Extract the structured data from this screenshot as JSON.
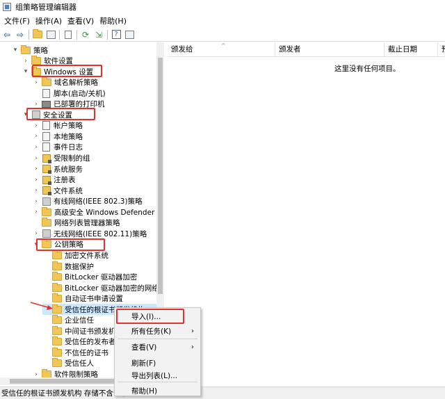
{
  "window": {
    "title": "组策略管理编辑器"
  },
  "menubar": {
    "items": [
      "文件(F)",
      "操作(A)",
      "查看(V)",
      "帮助(H)"
    ]
  },
  "tree": {
    "items": [
      {
        "label": "策略",
        "icon": "folder-icon",
        "chevron": "▾"
      },
      {
        "label": "软件设置",
        "icon": "folder-icon",
        "chevron": "›"
      },
      {
        "label": "Windows 设置",
        "icon": "folder-icon",
        "chevron": "▾",
        "highlighted": true
      },
      {
        "label": "域名解析策略",
        "icon": "folder-icon",
        "chevron": "›"
      },
      {
        "label": "脚本(启动/关机)",
        "icon": "script-icon",
        "chevron": ""
      },
      {
        "label": "已部署的打印机",
        "icon": "printer-icon",
        "chevron": "›"
      },
      {
        "label": "安全设置",
        "icon": "security-settings-icon",
        "chevron": "▾",
        "highlighted": true
      },
      {
        "label": "帐户策略",
        "icon": "policy-icon",
        "chevron": "›"
      },
      {
        "label": "本地策略",
        "icon": "policy-icon",
        "chevron": "›"
      },
      {
        "label": "事件日志",
        "icon": "policy-icon",
        "chevron": "›"
      },
      {
        "label": "受限制的组",
        "icon": "locked-folder-icon",
        "chevron": "›"
      },
      {
        "label": "系统服务",
        "icon": "locked-folder-icon",
        "chevron": "›"
      },
      {
        "label": "注册表",
        "icon": "locked-folder-icon",
        "chevron": "›"
      },
      {
        "label": "文件系统",
        "icon": "locked-folder-icon",
        "chevron": "›"
      },
      {
        "label": "有线网络(IEEE 802.3)策略",
        "icon": "network-policy-icon",
        "chevron": "›"
      },
      {
        "label": "高级安全 Windows Defender 防",
        "icon": "folder-icon",
        "chevron": "›"
      },
      {
        "label": "网络列表管理器策略",
        "icon": "folder-icon",
        "chevron": ""
      },
      {
        "label": "无线网络(IEEE 802.11)策略",
        "icon": "network-policy-icon",
        "chevron": "›"
      },
      {
        "label": "公钥策略",
        "icon": "folder-icon",
        "chevron": "▾",
        "highlighted": true
      },
      {
        "label": "加密文件系统",
        "icon": "folder-icon",
        "chevron": ""
      },
      {
        "label": "数据保护",
        "icon": "folder-icon",
        "chevron": ""
      },
      {
        "label": "BitLocker 驱动器加密",
        "icon": "folder-icon",
        "chevron": ""
      },
      {
        "label": "BitLocker 驱动器加密的网络",
        "icon": "folder-icon",
        "chevron": ""
      },
      {
        "label": "自动证书申请设置",
        "icon": "folder-icon",
        "chevron": ""
      },
      {
        "label": "受信任的根证书颁发机构",
        "icon": "folder-icon",
        "chevron": "",
        "selected": true
      },
      {
        "label": "企业信任",
        "icon": "folder-icon",
        "chevron": ""
      },
      {
        "label": "中间证书颁发机构",
        "icon": "folder-icon",
        "chevron": ""
      },
      {
        "label": "受信任的发布者",
        "icon": "folder-icon",
        "chevron": ""
      },
      {
        "label": "不信任的证书",
        "icon": "folder-icon",
        "chevron": ""
      },
      {
        "label": "受信任人",
        "icon": "folder-icon",
        "chevron": ""
      },
      {
        "label": "软件限制策略",
        "icon": "folder-icon",
        "chevron": "›"
      }
    ]
  },
  "list": {
    "columns": [
      "颁发给",
      "颁发者",
      "截止日期",
      "预"
    ],
    "empty_message": "这里没有任何项目。"
  },
  "context_menu": {
    "items": [
      {
        "label": "导入(I)...",
        "submenu": false,
        "highlighted": true
      },
      {
        "label": "所有任务(K)",
        "submenu": true
      },
      {
        "label": "查看(V)",
        "submenu": true
      },
      {
        "label": "刷新(F)",
        "submenu": false
      },
      {
        "label": "导出列表(L)...",
        "submenu": false
      },
      {
        "label": "帮助(H)",
        "submenu": false
      }
    ]
  },
  "statusbar": {
    "text": "受信任的根证书颁发机构 存储不含证书。"
  },
  "colors": {
    "highlight_red": "#e0332e",
    "selection_blue": "#cce8ff",
    "folder_yellow": "#f1c659"
  }
}
